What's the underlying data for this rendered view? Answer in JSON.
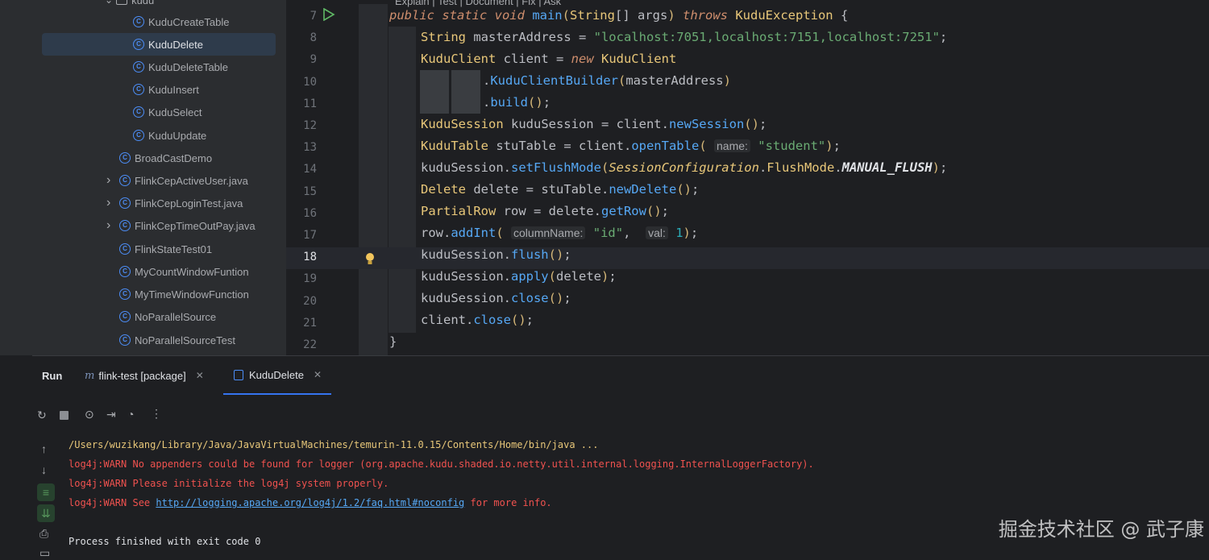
{
  "tree": {
    "partial_label": "kudu",
    "items": [
      {
        "label": "KuduCreateTable"
      },
      {
        "label": "KuduDelete"
      },
      {
        "label": "KuduDeleteTable"
      },
      {
        "label": "KuduInsert"
      },
      {
        "label": "KuduSelect"
      },
      {
        "label": "KuduUpdate"
      },
      {
        "label": "BroadCastDemo"
      },
      {
        "label": "FlinkCepActiveUser.java"
      },
      {
        "label": "FlinkCepLoginTest.java"
      },
      {
        "label": "FlinkCepTimeOutPay.java"
      },
      {
        "label": "FlinkStateTest01"
      },
      {
        "label": "MyCountWindowFuntion"
      },
      {
        "label": "MyTimeWindowFunction"
      },
      {
        "label": "NoParallelSource"
      },
      {
        "label": "NoParallelSourceTest"
      }
    ]
  },
  "editor": {
    "ai_hint": "Explain | Test | Document | Fix | Ask",
    "line_numbers": [
      "7",
      "8",
      "9",
      "10",
      "11",
      "12",
      "13",
      "14",
      "15",
      "16",
      "17",
      "18",
      "19",
      "20",
      "21",
      "22"
    ],
    "hints": {
      "name": "name:",
      "columnName": "columnName:",
      "val": "val:"
    }
  },
  "run": {
    "title": "Run",
    "tabs": [
      {
        "label": "flink-test [package]"
      },
      {
        "label": "KuduDelete"
      }
    ],
    "output": {
      "line1": "/Users/wuzikang/Library/Java/JavaVirtualMachines/temurin-11.0.15/Contents/Home/bin/java ...",
      "line2": "log4j:WARN No appenders could be found for logger (org.apache.kudu.shaded.io.netty.util.internal.logging.InternalLoggerFactory).",
      "line3": "log4j:WARN Please initialize the log4j system properly.",
      "line4_prefix": "log4j:WARN See ",
      "line4_link": "http://logging.apache.org/log4j/1.2/faq.html#noconfig",
      "line4_suffix": " for more info.",
      "line5": "Process finished with exit code 0"
    }
  },
  "watermark": "掘金技术社区 @ 武子康",
  "colors": {
    "accent": "#4c8df6",
    "warn": "#f0524f",
    "path": "#e8c779",
    "keyword": "#cf8e6d",
    "string": "#6aab73"
  }
}
